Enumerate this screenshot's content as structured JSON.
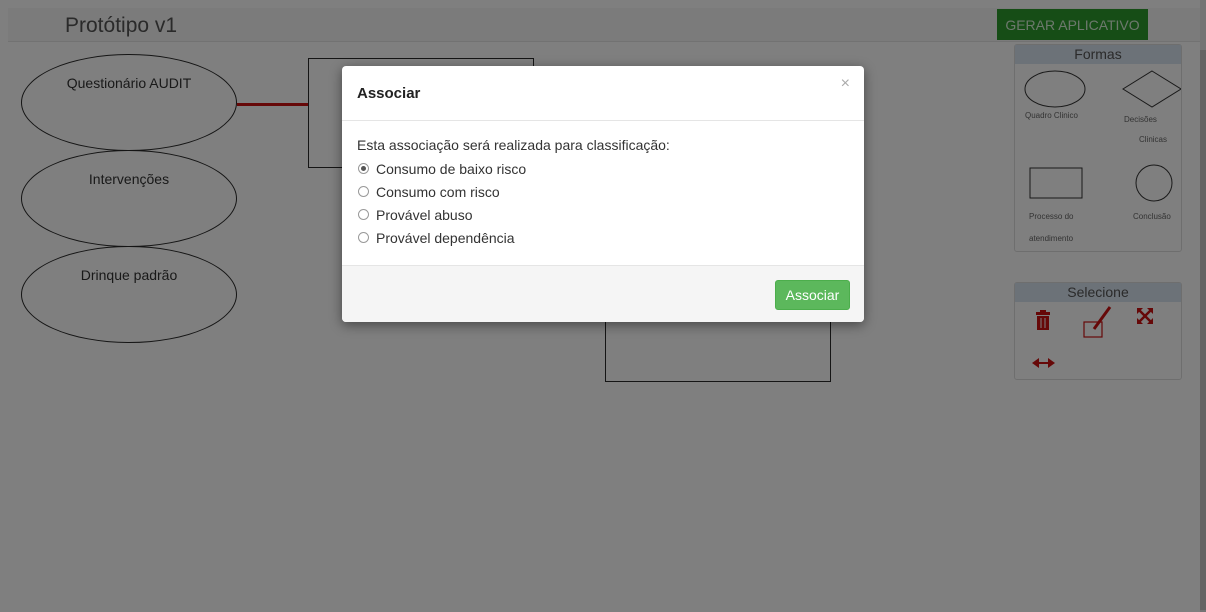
{
  "app": {
    "title": "Protótipo v1",
    "generate_label": "GERAR APLICATIVO"
  },
  "canvas": {
    "ellipses": [
      "Questionário AUDIT",
      "Intervenções",
      "Drinque padrão"
    ]
  },
  "shapes_panel": {
    "title": "Formas",
    "labels": {
      "quadro": "Quadro Clinico",
      "decisoes_1": "Decisões",
      "decisoes_2": "Clinicas",
      "processo_1": "Processo do",
      "processo_2": "atendimento",
      "conclusao": "Conclusão"
    }
  },
  "select_panel": {
    "title": "Selecione",
    "icons": [
      "trash-icon",
      "edit-icon",
      "expand-icon",
      "swap-icon"
    ],
    "accent": "#cc1111"
  },
  "modal": {
    "title": "Associar",
    "close": "×",
    "prompt": "Esta associação será realizada para classificação:",
    "options": [
      "Consumo de baixo risco",
      "Consumo com risco",
      "Provável abuso",
      "Provável dependência"
    ],
    "selected": "Consumo de baixo risco",
    "submit": "Associar"
  },
  "colors": {
    "primary_green": "#2d9a2d",
    "button_green": "#5cb85c",
    "link_red": "#cc1111"
  }
}
